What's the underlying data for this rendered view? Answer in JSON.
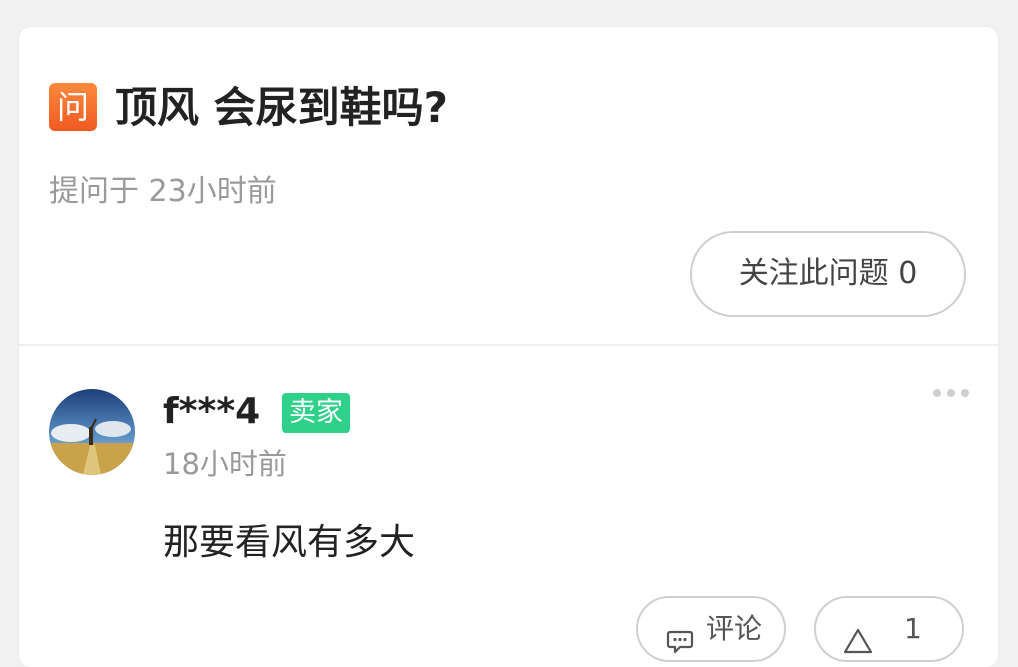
{
  "question": {
    "badge": "问",
    "title": "顶风 会尿到鞋吗?",
    "asked_time": "提问于 23小时前",
    "follow_label": "关注此问题 0"
  },
  "answer": {
    "username": "f***4",
    "badge": "卖家",
    "time": "18小时前",
    "text": "那要看风有多大",
    "comment_label": "评论",
    "like_count": "1"
  },
  "icons": {
    "more": "more-dots-icon",
    "comment": "comment-bubble-icon",
    "like": "triangle-up-icon"
  },
  "colors": {
    "badge_orange": "#f26b2a",
    "seller_green": "#2fd08a",
    "text_dark": "#222222",
    "text_gray": "#9a9a9a"
  }
}
